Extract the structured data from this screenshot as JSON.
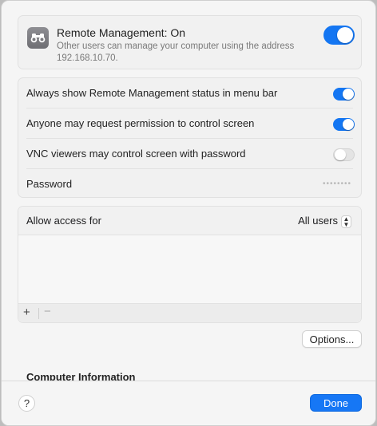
{
  "header": {
    "title": "Remote Management: On",
    "subtitle": "Other users can manage your computer using the address 192.168.10.70.",
    "toggle_on": true
  },
  "settings": {
    "rows": [
      {
        "label": "Always show Remote Management status in menu bar",
        "toggle": true
      },
      {
        "label": "Anyone may request permission to control screen",
        "toggle": true
      },
      {
        "label": "VNC viewers may control screen with password",
        "toggle": false
      }
    ],
    "password_label": "Password",
    "password_value": "••••••••"
  },
  "access": {
    "label": "Allow access for",
    "value": "All users",
    "add_symbol": "+",
    "remove_symbol": "−"
  },
  "options_label": "Options...",
  "next_section_label": "Computer Information",
  "footer": {
    "help_label": "?",
    "done_label": "Done"
  },
  "colors": {
    "accent": "#1476F2",
    "background": "#F5F5F5"
  }
}
